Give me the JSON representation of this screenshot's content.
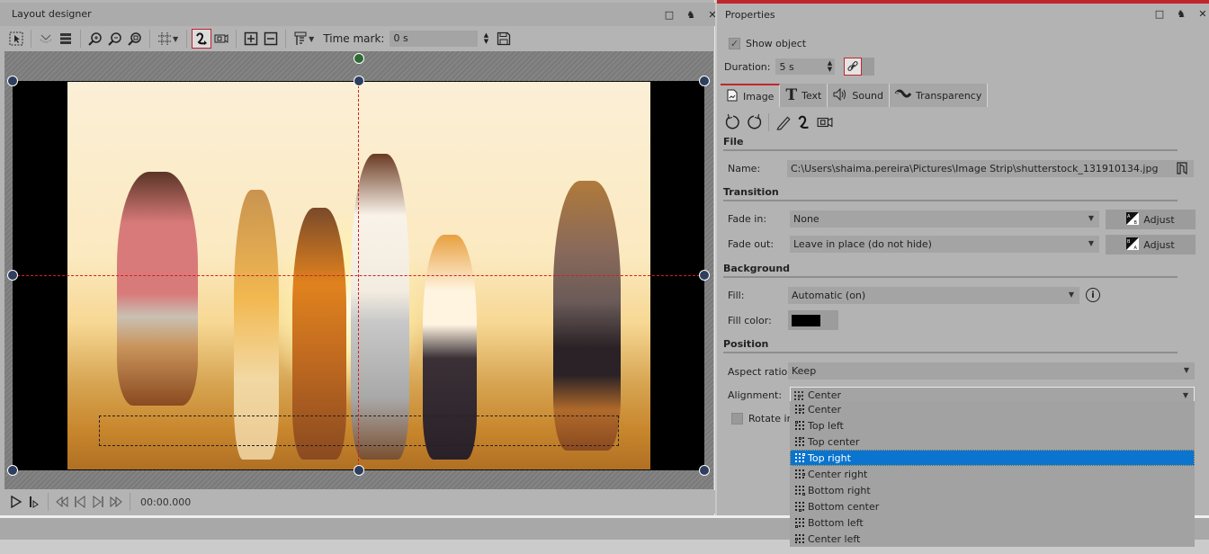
{
  "layout_designer": {
    "title": "Layout designer",
    "window_buttons": [
      "maximize",
      "pin",
      "close"
    ],
    "toolbar": {
      "time_mark_label": "Time mark:",
      "time_mark_value": "0 s"
    },
    "transport": {
      "timecode": "00:00.000"
    }
  },
  "properties": {
    "title": "Properties",
    "show_object_label": "Show object",
    "show_object_checked": true,
    "duration_label": "Duration:",
    "duration_value": "5 s",
    "tabs": [
      {
        "label": "Image",
        "icon": "image-icon",
        "selected": true
      },
      {
        "label": "Text",
        "icon": "text-icon",
        "selected": false
      },
      {
        "label": "Sound",
        "icon": "speaker-icon",
        "selected": false
      },
      {
        "label": "Transparency",
        "icon": "transparency-icon",
        "selected": false
      }
    ],
    "file": {
      "heading": "File",
      "name_label": "Name:",
      "name_value": "C:\\Users\\shaima.pereira\\Pictures\\Image Strip\\shutterstock_131910134.jpg"
    },
    "transition": {
      "heading": "Transition",
      "fade_in_label": "Fade in:",
      "fade_in_value": "None",
      "fade_out_label": "Fade out:",
      "fade_out_value": "Leave in place (do not hide)",
      "adjust_label": "Adjust"
    },
    "background": {
      "heading": "Background",
      "fill_label": "Fill:",
      "fill_value": "Automatic (on)",
      "fill_color_label": "Fill color:",
      "fill_color": "#000000"
    },
    "position": {
      "heading": "Position",
      "aspect_label": "Aspect ratio:",
      "aspect_value": "Keep",
      "alignment_label": "Alignment:",
      "alignment_value": "Center",
      "rotate_label": "Rotate in r",
      "alignment_options": [
        "Center",
        "Top left",
        "Top center",
        "Top right",
        "Center right",
        "Bottom right",
        "Bottom center",
        "Bottom left",
        "Center left"
      ],
      "highlighted_option": "Top right"
    }
  },
  "colors": {
    "accent_red": "#c0272d",
    "selection_blue": "#0a74cf"
  }
}
